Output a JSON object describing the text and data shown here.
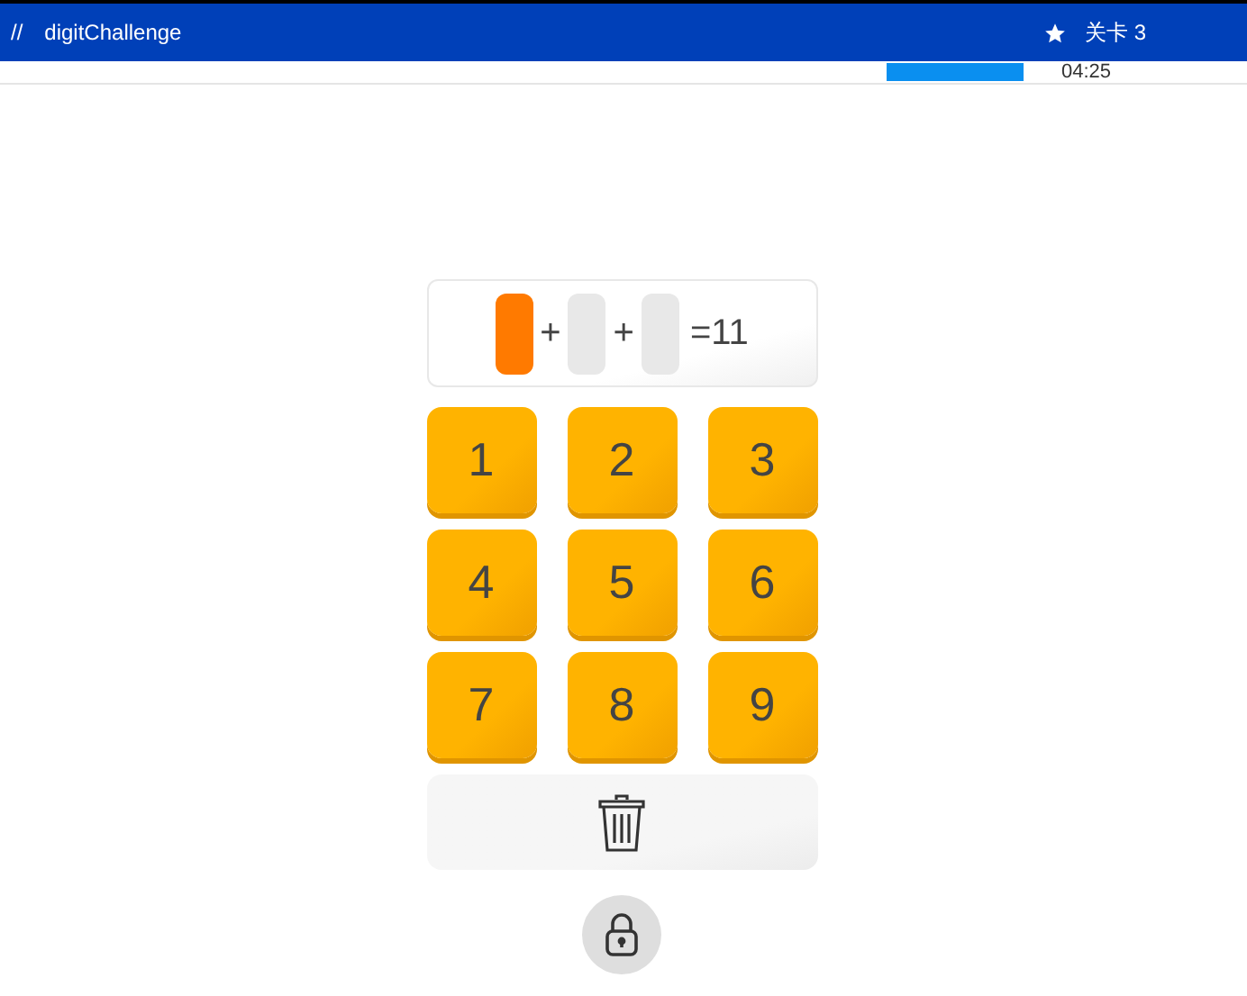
{
  "header": {
    "menu_glyph": "//",
    "title": "digitChallenge",
    "level_label": "关卡 3"
  },
  "progress": {
    "time": "04:25"
  },
  "equation": {
    "slots": [
      {
        "selected": true
      },
      {
        "selected": false
      },
      {
        "selected": false
      }
    ],
    "operators": [
      "+",
      "+"
    ],
    "result": "=11"
  },
  "keypad": [
    "1",
    "2",
    "3",
    "4",
    "5",
    "6",
    "7",
    "8",
    "9"
  ]
}
